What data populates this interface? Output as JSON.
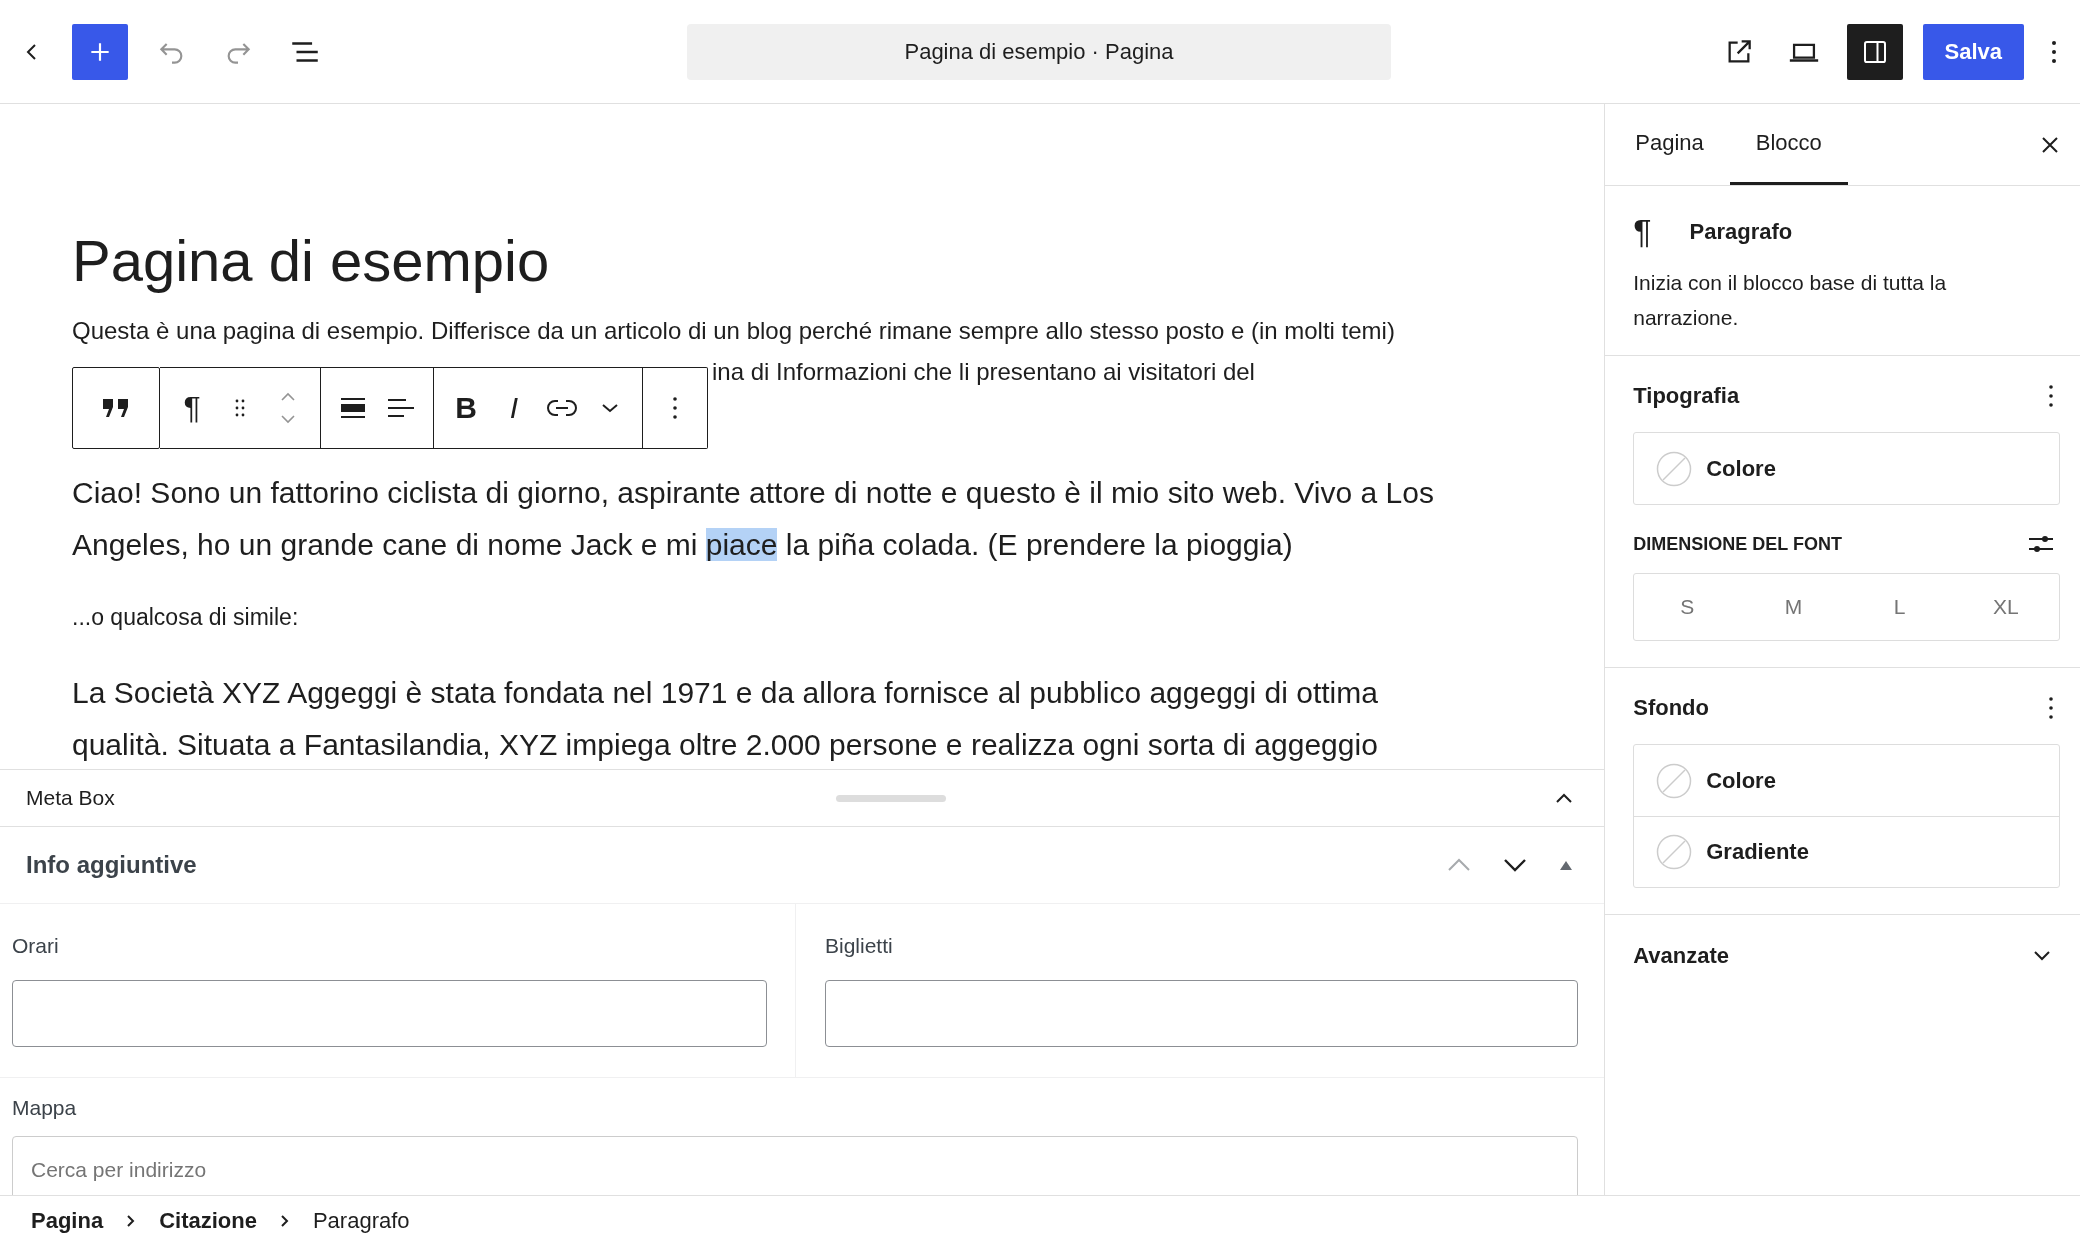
{
  "top_bar": {
    "document_title": "Pagina di esempio · Pagina",
    "save_label": "Salva",
    "settings_open": true
  },
  "editor": {
    "title": "Pagina di esempio",
    "intro_line": "Questa è una pagina di esempio. Differisce da un articolo di un blog perché rimane sempre allo stesso posto e (in molti temi)",
    "intro_visible_fragment": "ina di Informazioni che li presentano ai visitatori del",
    "block_toolbar": {
      "pilcrow": "¶",
      "bold": "B",
      "italic": "I"
    },
    "paragraphs": [
      {
        "kind": "large",
        "segments": [
          {
            "text": "Ciao! Sono un fattorino ciclista di giorno, aspirante attore di notte e questo è il mio sito web. Vivo a Los Angeles, ho un grande cane di nome Jack e mi ",
            "selected": false
          },
          {
            "text": "piace",
            "selected": true
          },
          {
            "text": " la piña colada. (E prendere la pioggia)",
            "selected": false
          }
        ]
      },
      {
        "kind": "small",
        "segments": [
          {
            "text": "...o qualcosa di simile:",
            "selected": false
          }
        ]
      },
      {
        "kind": "large",
        "segments": [
          {
            "text": "La Società XYZ Aggeggi è stata fondata nel 1971 e da allora fornisce al pubblico aggeggi di ottima qualità. Situata a Fantasilandia, XYZ impiega oltre 2.000 persone e realizza ogni sorta di aggeggio",
            "selected": false
          }
        ]
      }
    ]
  },
  "sidebar": {
    "tabs": [
      {
        "label": "Pagina",
        "selected": false
      },
      {
        "label": "Blocco",
        "selected": true
      }
    ],
    "block": {
      "icon": "¶",
      "name": "Paragrafo",
      "description": "Inizia con il blocco base di tutta la narrazione."
    },
    "typography": {
      "title": "Tipografia",
      "color_label": "Colore",
      "font_size_label": "DIMENSIONE DEL FONT",
      "sizes": [
        {
          "label": "S",
          "selected": false
        },
        {
          "label": "M",
          "selected": false
        },
        {
          "label": "L",
          "selected": false
        },
        {
          "label": "XL",
          "selected": false
        }
      ]
    },
    "background": {
      "title": "Sfondo",
      "items": [
        "Colore",
        "Gradiente"
      ]
    },
    "advanced": {
      "title": "Avanzate",
      "expanded": false
    }
  },
  "meta_box": {
    "title": "Meta Box",
    "expanded": true,
    "panel": {
      "title": "Info aggiuntive",
      "expanded": true,
      "fields": [
        {
          "kind": "half",
          "label": "Orari"
        },
        {
          "kind": "half",
          "label": "Biglietti"
        },
        {
          "kind": "full",
          "label": "Mappa",
          "placeholder": "Cerca per indirizzo"
        }
      ]
    }
  },
  "breadcrumb": [
    {
      "label": "Pagina",
      "current": false
    },
    {
      "label": "Citazione",
      "current": false
    },
    {
      "label": "Paragrafo",
      "current": true
    }
  ]
}
